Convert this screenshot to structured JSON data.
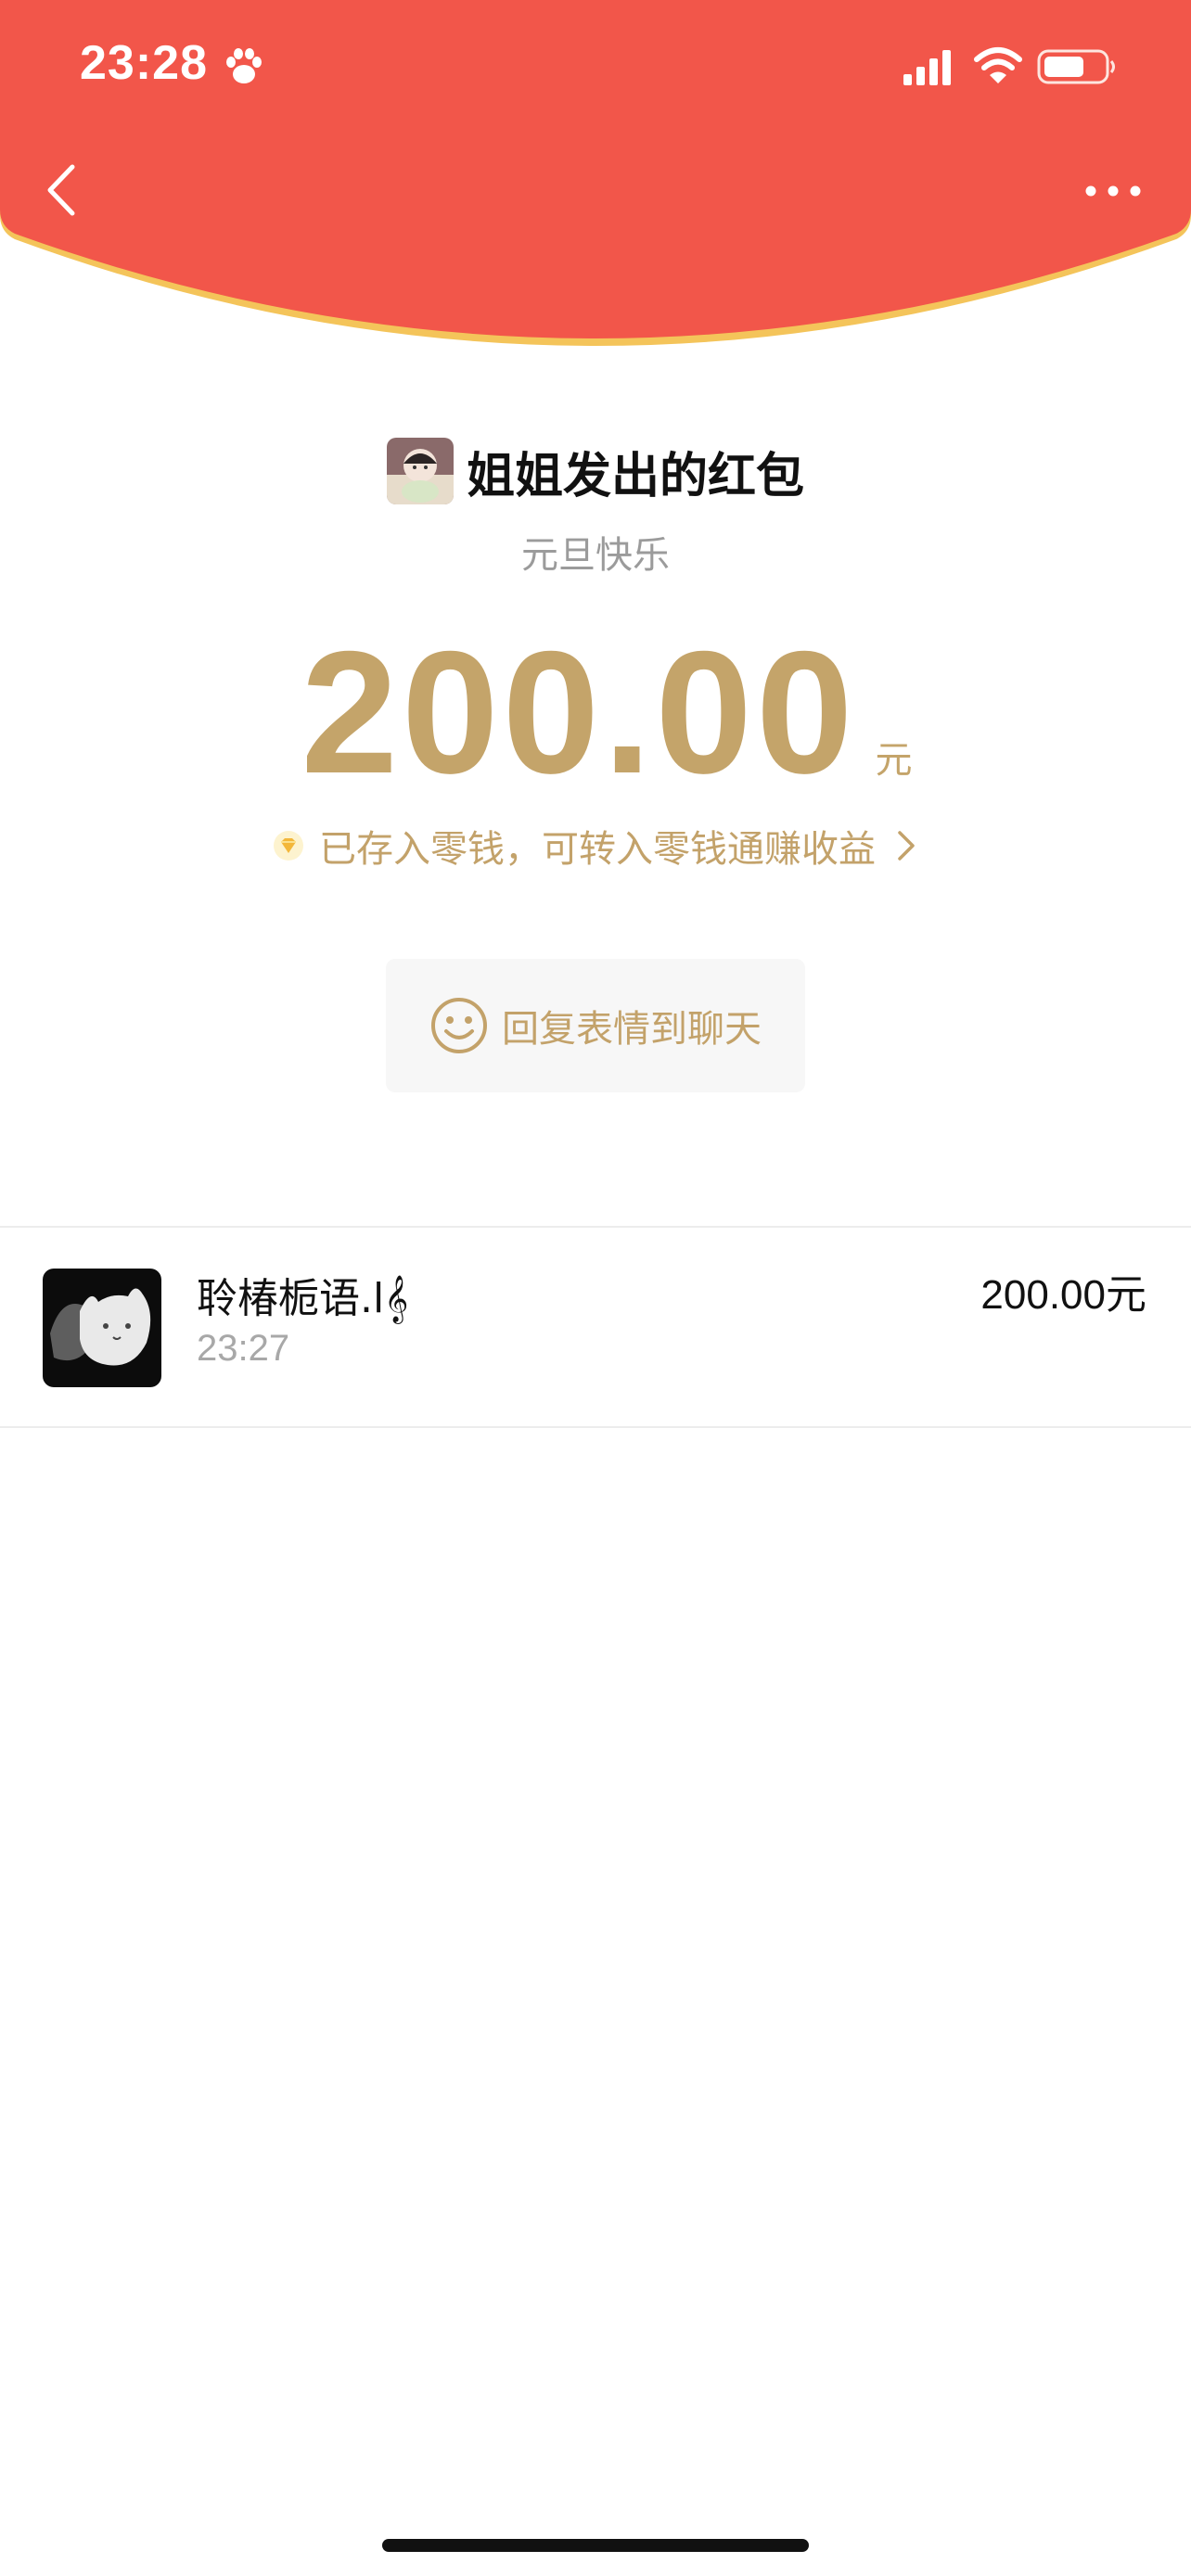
{
  "status_bar": {
    "time": "23:28"
  },
  "header": {
    "background_color": "#f2564a",
    "rim_color": "#f4c45a"
  },
  "packet": {
    "sender_title": "姐姐发出的红包",
    "greeting": "元旦快乐",
    "amount": "200.00",
    "unit": "元",
    "notice": "已存入零钱，可转入零钱通赚收益",
    "reply_label": "回复表情到聊天"
  },
  "records": [
    {
      "name": "聆椿栀语.l𝄞",
      "time": "23:27",
      "amount": "200.00元"
    }
  ],
  "colors": {
    "gold": "#c4a46a",
    "text": "#111111",
    "muted": "#9b9b9b"
  }
}
